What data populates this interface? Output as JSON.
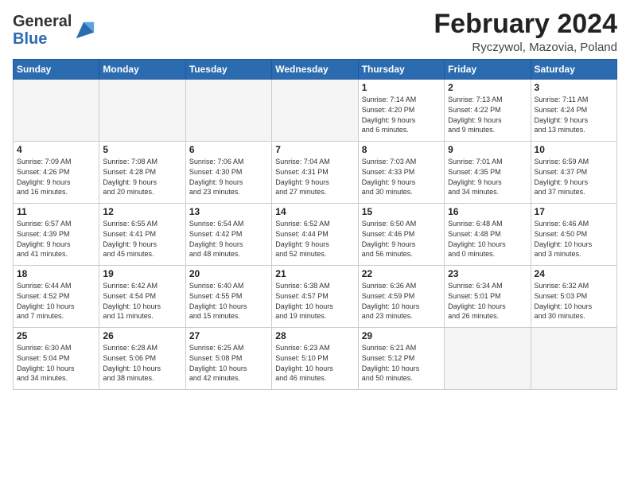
{
  "header": {
    "logo_general": "General",
    "logo_blue": "Blue",
    "month": "February 2024",
    "location": "Ryczywol, Mazovia, Poland"
  },
  "days_of_week": [
    "Sunday",
    "Monday",
    "Tuesday",
    "Wednesday",
    "Thursday",
    "Friday",
    "Saturday"
  ],
  "weeks": [
    [
      {
        "day": "",
        "info": ""
      },
      {
        "day": "",
        "info": ""
      },
      {
        "day": "",
        "info": ""
      },
      {
        "day": "",
        "info": ""
      },
      {
        "day": "1",
        "info": "Sunrise: 7:14 AM\nSunset: 4:20 PM\nDaylight: 9 hours\nand 6 minutes."
      },
      {
        "day": "2",
        "info": "Sunrise: 7:13 AM\nSunset: 4:22 PM\nDaylight: 9 hours\nand 9 minutes."
      },
      {
        "day": "3",
        "info": "Sunrise: 7:11 AM\nSunset: 4:24 PM\nDaylight: 9 hours\nand 13 minutes."
      }
    ],
    [
      {
        "day": "4",
        "info": "Sunrise: 7:09 AM\nSunset: 4:26 PM\nDaylight: 9 hours\nand 16 minutes."
      },
      {
        "day": "5",
        "info": "Sunrise: 7:08 AM\nSunset: 4:28 PM\nDaylight: 9 hours\nand 20 minutes."
      },
      {
        "day": "6",
        "info": "Sunrise: 7:06 AM\nSunset: 4:30 PM\nDaylight: 9 hours\nand 23 minutes."
      },
      {
        "day": "7",
        "info": "Sunrise: 7:04 AM\nSunset: 4:31 PM\nDaylight: 9 hours\nand 27 minutes."
      },
      {
        "day": "8",
        "info": "Sunrise: 7:03 AM\nSunset: 4:33 PM\nDaylight: 9 hours\nand 30 minutes."
      },
      {
        "day": "9",
        "info": "Sunrise: 7:01 AM\nSunset: 4:35 PM\nDaylight: 9 hours\nand 34 minutes."
      },
      {
        "day": "10",
        "info": "Sunrise: 6:59 AM\nSunset: 4:37 PM\nDaylight: 9 hours\nand 37 minutes."
      }
    ],
    [
      {
        "day": "11",
        "info": "Sunrise: 6:57 AM\nSunset: 4:39 PM\nDaylight: 9 hours\nand 41 minutes."
      },
      {
        "day": "12",
        "info": "Sunrise: 6:55 AM\nSunset: 4:41 PM\nDaylight: 9 hours\nand 45 minutes."
      },
      {
        "day": "13",
        "info": "Sunrise: 6:54 AM\nSunset: 4:42 PM\nDaylight: 9 hours\nand 48 minutes."
      },
      {
        "day": "14",
        "info": "Sunrise: 6:52 AM\nSunset: 4:44 PM\nDaylight: 9 hours\nand 52 minutes."
      },
      {
        "day": "15",
        "info": "Sunrise: 6:50 AM\nSunset: 4:46 PM\nDaylight: 9 hours\nand 56 minutes."
      },
      {
        "day": "16",
        "info": "Sunrise: 6:48 AM\nSunset: 4:48 PM\nDaylight: 10 hours\nand 0 minutes."
      },
      {
        "day": "17",
        "info": "Sunrise: 6:46 AM\nSunset: 4:50 PM\nDaylight: 10 hours\nand 3 minutes."
      }
    ],
    [
      {
        "day": "18",
        "info": "Sunrise: 6:44 AM\nSunset: 4:52 PM\nDaylight: 10 hours\nand 7 minutes."
      },
      {
        "day": "19",
        "info": "Sunrise: 6:42 AM\nSunset: 4:54 PM\nDaylight: 10 hours\nand 11 minutes."
      },
      {
        "day": "20",
        "info": "Sunrise: 6:40 AM\nSunset: 4:55 PM\nDaylight: 10 hours\nand 15 minutes."
      },
      {
        "day": "21",
        "info": "Sunrise: 6:38 AM\nSunset: 4:57 PM\nDaylight: 10 hours\nand 19 minutes."
      },
      {
        "day": "22",
        "info": "Sunrise: 6:36 AM\nSunset: 4:59 PM\nDaylight: 10 hours\nand 23 minutes."
      },
      {
        "day": "23",
        "info": "Sunrise: 6:34 AM\nSunset: 5:01 PM\nDaylight: 10 hours\nand 26 minutes."
      },
      {
        "day": "24",
        "info": "Sunrise: 6:32 AM\nSunset: 5:03 PM\nDaylight: 10 hours\nand 30 minutes."
      }
    ],
    [
      {
        "day": "25",
        "info": "Sunrise: 6:30 AM\nSunset: 5:04 PM\nDaylight: 10 hours\nand 34 minutes."
      },
      {
        "day": "26",
        "info": "Sunrise: 6:28 AM\nSunset: 5:06 PM\nDaylight: 10 hours\nand 38 minutes."
      },
      {
        "day": "27",
        "info": "Sunrise: 6:25 AM\nSunset: 5:08 PM\nDaylight: 10 hours\nand 42 minutes."
      },
      {
        "day": "28",
        "info": "Sunrise: 6:23 AM\nSunset: 5:10 PM\nDaylight: 10 hours\nand 46 minutes."
      },
      {
        "day": "29",
        "info": "Sunrise: 6:21 AM\nSunset: 5:12 PM\nDaylight: 10 hours\nand 50 minutes."
      },
      {
        "day": "",
        "info": ""
      },
      {
        "day": "",
        "info": ""
      }
    ]
  ]
}
